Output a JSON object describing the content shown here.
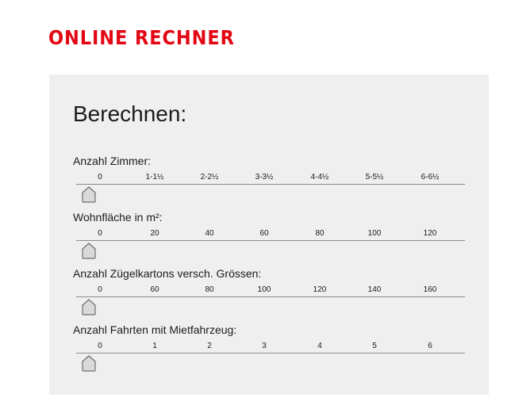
{
  "header": {
    "brand_title": "ONLINE RECHNER"
  },
  "calculator": {
    "title": "Berechnen:",
    "sliders": [
      {
        "label": "Anzahl Zimmer:",
        "ticks": [
          "0",
          "1-1½",
          "2-2½",
          "3-3½",
          "4-4½",
          "5-5½",
          "6-6½"
        ],
        "value": "0"
      },
      {
        "label": "Wohnfläche in m²:",
        "ticks": [
          "0",
          "20",
          "40",
          "60",
          "80",
          "100",
          "120"
        ],
        "value": "0"
      },
      {
        "label": "Anzahl Zügelkartons versch. Grössen:",
        "ticks": [
          "0",
          "60",
          "80",
          "100",
          "120",
          "140",
          "160"
        ],
        "value": "0"
      },
      {
        "label": "Anzahl Fahrten mit Mietfahrzeug:",
        "ticks": [
          "0",
          "1",
          "2",
          "3",
          "4",
          "5",
          "6"
        ],
        "value": "0"
      }
    ]
  },
  "colors": {
    "brand": "#e30613",
    "panel_bg": "#efefef",
    "track": "#8c8c8c",
    "handle_fill": "#d9d9d9",
    "handle_stroke": "#6e6e6e"
  }
}
